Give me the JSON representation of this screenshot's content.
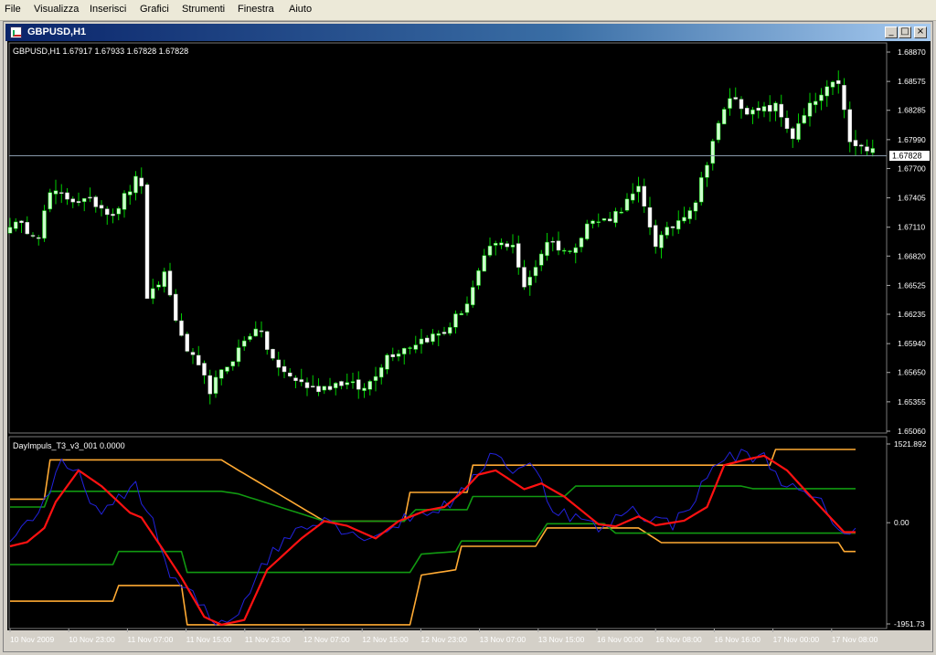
{
  "menu": [
    "File",
    "Visualizza",
    "Inserisci",
    "Grafici",
    "Strumenti",
    "Finestra",
    "Aiuto"
  ],
  "window": {
    "title": "GBPUSD,H1",
    "minimize": "_",
    "restore": "□",
    "close": "×"
  },
  "colors": {
    "bull": "#ccffcc",
    "bear": "#ffffff",
    "wick": "#00cc00",
    "bid_line": "#8899aa",
    "grid": "#333333",
    "t3": "#ff1111",
    "impulse": "#2222dd",
    "outer_band": "#ffaa33",
    "inner_band": "#119911"
  },
  "price_panel": {
    "label": "GBPUSD,H1  1.67917 1.67933 1.67828 1.67828",
    "y_ticks": [
      "1.68870",
      "1.68575",
      "1.68285",
      "1.67990",
      "1.67700",
      "1.67405",
      "1.67110",
      "1.66820",
      "1.66525",
      "1.66235",
      "1.65940",
      "1.65650",
      "1.65355",
      "1.65060"
    ],
    "current_price": "1.67828",
    "ylim": [
      1.6506,
      1.6887
    ]
  },
  "indicator_panel": {
    "label": "DayImpuls_T3_v3_001 0.0000",
    "y_ticks": [
      "1521.892",
      "0.00",
      "-1951.73"
    ],
    "ylim": [
      -1951.73,
      1521.892
    ]
  },
  "x_ticks": [
    "10 Nov 2009",
    "10 Nov 23:00",
    "11 Nov 07:00",
    "11 Nov 15:00",
    "11 Nov 23:00",
    "12 Nov 07:00",
    "12 Nov 15:00",
    "12 Nov 23:00",
    "13 Nov 07:00",
    "13 Nov 15:00",
    "16 Nov 00:00",
    "16 Nov 08:00",
    "16 Nov 16:00",
    "17 Nov 00:00",
    "17 Nov 08:00"
  ],
  "chart_data": {
    "type": "candlestick",
    "title": "GBPUSD,H1",
    "ylim": [
      1.6506,
      1.6887
    ],
    "anchors": [
      [
        0,
        1.6715
      ],
      [
        5,
        1.6705
      ],
      [
        7,
        1.6745
      ],
      [
        12,
        1.6738
      ],
      [
        15,
        1.6735
      ],
      [
        18,
        1.6725
      ],
      [
        22,
        1.6758
      ],
      [
        23,
        1.6755
      ],
      [
        24,
        1.6635
      ],
      [
        27,
        1.6665
      ],
      [
        30,
        1.6598
      ],
      [
        35,
        1.6548
      ],
      [
        40,
        1.6588
      ],
      [
        43,
        1.6612
      ],
      [
        47,
        1.6568
      ],
      [
        53,
        1.6548
      ],
      [
        58,
        1.6555
      ],
      [
        62,
        1.6548
      ],
      [
        66,
        1.6582
      ],
      [
        72,
        1.6598
      ],
      [
        76,
        1.6605
      ],
      [
        80,
        1.6635
      ],
      [
        84,
        1.6692
      ],
      [
        88,
        1.6695
      ],
      [
        90,
        1.6648
      ],
      [
        94,
        1.6698
      ],
      [
        98,
        1.6685
      ],
      [
        101,
        1.6715
      ],
      [
        104,
        1.6718
      ],
      [
        106,
        1.6725
      ],
      [
        110,
        1.6748
      ],
      [
        113,
        1.6695
      ],
      [
        116,
        1.6712
      ],
      [
        120,
        1.6738
      ],
      [
        123,
        1.6798
      ],
      [
        126,
        1.6842
      ],
      [
        130,
        1.6825
      ],
      [
        134,
        1.6832
      ],
      [
        137,
        1.6802
      ],
      [
        140,
        1.6832
      ],
      [
        143,
        1.6848
      ],
      [
        145,
        1.6858
      ],
      [
        147,
        1.6795
      ],
      [
        150,
        1.6788
      ],
      [
        151,
        1.6788
      ]
    ],
    "indicator": {
      "t3": [
        [
          0,
          -450
        ],
        [
          3,
          -370
        ],
        [
          6,
          -100
        ],
        [
          8,
          400
        ],
        [
          12,
          1000
        ],
        [
          16,
          700
        ],
        [
          21,
          190
        ],
        [
          23,
          100
        ],
        [
          27,
          -550
        ],
        [
          30,
          -1050
        ],
        [
          34,
          -1800
        ],
        [
          37,
          -1950
        ],
        [
          41,
          -1860
        ],
        [
          45,
          -900
        ],
        [
          51,
          -300
        ],
        [
          55,
          30
        ],
        [
          59,
          -60
        ],
        [
          64,
          -300
        ],
        [
          68,
          30
        ],
        [
          73,
          240
        ],
        [
          76,
          300
        ],
        [
          79,
          570
        ],
        [
          82,
          920
        ],
        [
          85,
          1000
        ],
        [
          90,
          640
        ],
        [
          93,
          750
        ],
        [
          97,
          500
        ],
        [
          103,
          -30
        ],
        [
          106,
          -70
        ],
        [
          110,
          120
        ],
        [
          113,
          -50
        ],
        [
          118,
          40
        ],
        [
          122,
          300
        ],
        [
          125,
          1100
        ],
        [
          129,
          1210
        ],
        [
          132,
          1280
        ],
        [
          136,
          1000
        ],
        [
          141,
          400
        ],
        [
          146,
          -180
        ]
      ],
      "impulse": [
        [
          0,
          -300
        ],
        [
          4,
          100
        ],
        [
          7,
          600
        ],
        [
          9,
          1100
        ],
        [
          12,
          900
        ],
        [
          16,
          100
        ],
        [
          20,
          550
        ],
        [
          22,
          750
        ],
        [
          26,
          -300
        ],
        [
          28,
          -1050
        ],
        [
          32,
          -1400
        ],
        [
          36,
          -1950
        ],
        [
          40,
          -1700
        ],
        [
          44,
          -800
        ],
        [
          50,
          -130
        ],
        [
          55,
          120
        ],
        [
          60,
          -250
        ],
        [
          65,
          -200
        ],
        [
          70,
          120
        ],
        [
          74,
          250
        ],
        [
          78,
          400
        ],
        [
          82,
          1000
        ],
        [
          85,
          1400
        ],
        [
          88,
          950
        ],
        [
          92,
          1100
        ],
        [
          95,
          250
        ],
        [
          98,
          150
        ],
        [
          101,
          0
        ],
        [
          104,
          -150
        ],
        [
          108,
          300
        ],
        [
          112,
          100
        ],
        [
          116,
          -30
        ],
        [
          120,
          500
        ],
        [
          124,
          1200
        ],
        [
          128,
          1300
        ],
        [
          132,
          1250
        ],
        [
          136,
          700
        ],
        [
          142,
          350
        ],
        [
          146,
          -200
        ],
        [
          148,
          -170
        ]
      ],
      "outer_upper": [
        [
          0,
          450
        ],
        [
          6,
          450
        ],
        [
          7,
          1200
        ],
        [
          37,
          1200
        ],
        [
          40,
          1000
        ],
        [
          55,
          30
        ],
        [
          69,
          30
        ],
        [
          70,
          580
        ],
        [
          80,
          580
        ],
        [
          81,
          1100
        ],
        [
          133,
          1100
        ],
        [
          134,
          1400
        ],
        [
          148,
          1400
        ]
      ],
      "outer_lower": [
        [
          0,
          -1500
        ],
        [
          18,
          -1500
        ],
        [
          19,
          -1200
        ],
        [
          30,
          -1200
        ],
        [
          31,
          -1950
        ],
        [
          70,
          -1950
        ],
        [
          72,
          -1000
        ],
        [
          78,
          -900
        ],
        [
          79,
          -450
        ],
        [
          92,
          -450
        ],
        [
          94,
          -100
        ],
        [
          110,
          -100
        ],
        [
          114,
          -380
        ],
        [
          145,
          -380
        ],
        [
          146,
          -550
        ],
        [
          148,
          -550
        ]
      ],
      "inner_upper": [
        [
          0,
          300
        ],
        [
          6,
          300
        ],
        [
          7,
          600
        ],
        [
          37,
          600
        ],
        [
          40,
          550
        ],
        [
          55,
          30
        ],
        [
          69,
          30
        ],
        [
          71,
          250
        ],
        [
          80,
          250
        ],
        [
          81,
          500
        ],
        [
          97,
          500
        ],
        [
          99,
          700
        ],
        [
          128,
          700
        ],
        [
          130,
          650
        ],
        [
          148,
          650
        ]
      ],
      "inner_lower": [
        [
          0,
          -800
        ],
        [
          18,
          -800
        ],
        [
          19,
          -550
        ],
        [
          30,
          -550
        ],
        [
          31,
          -950
        ],
        [
          70,
          -950
        ],
        [
          72,
          -600
        ],
        [
          78,
          -550
        ],
        [
          79,
          -350
        ],
        [
          92,
          -350
        ],
        [
          94,
          -20
        ],
        [
          104,
          -20
        ],
        [
          106,
          -200
        ],
        [
          148,
          -200
        ]
      ]
    }
  }
}
